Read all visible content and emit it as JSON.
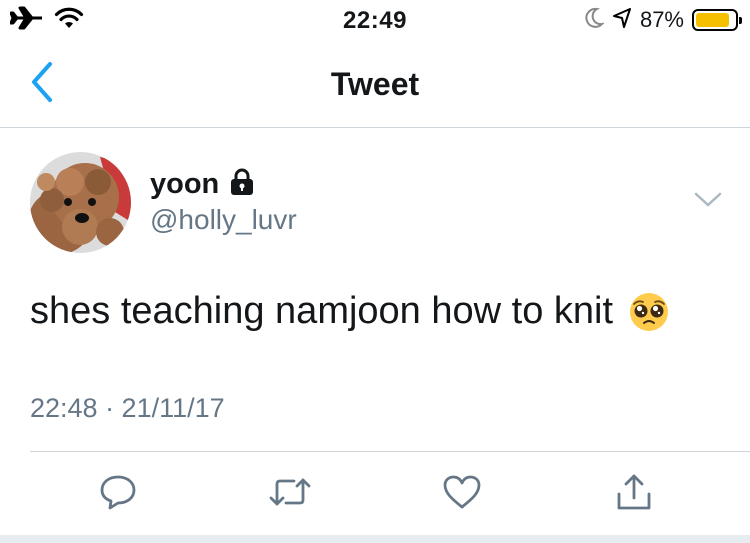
{
  "status_bar": {
    "time": "22:49",
    "battery_percent_label": "87%",
    "battery_level": 0.87,
    "battery_color": "#f5c000",
    "left_icons": [
      "airplane-icon",
      "wifi-icon"
    ],
    "right_icons": [
      "moon-icon",
      "location-arrow-icon",
      "battery-icon"
    ]
  },
  "nav": {
    "title": "Tweet",
    "back_icon": "chevron-left-icon",
    "accent_color": "#1da1f2"
  },
  "tweet": {
    "author": {
      "display_name": "yoon",
      "handle": "@holly_luvr",
      "protected": true,
      "lock_icon": "lock-icon"
    },
    "text": "shes teaching namjoon how to knit",
    "emoji": "pleading-face-emoji",
    "timestamp": "22:48 · 21/11/17",
    "menu_icon": "chevron-down-icon"
  },
  "actions": [
    {
      "name": "reply",
      "icon": "reply-icon"
    },
    {
      "name": "retweet",
      "icon": "retweet-icon"
    },
    {
      "name": "like",
      "icon": "heart-icon"
    },
    {
      "name": "share",
      "icon": "share-icon"
    }
  ]
}
